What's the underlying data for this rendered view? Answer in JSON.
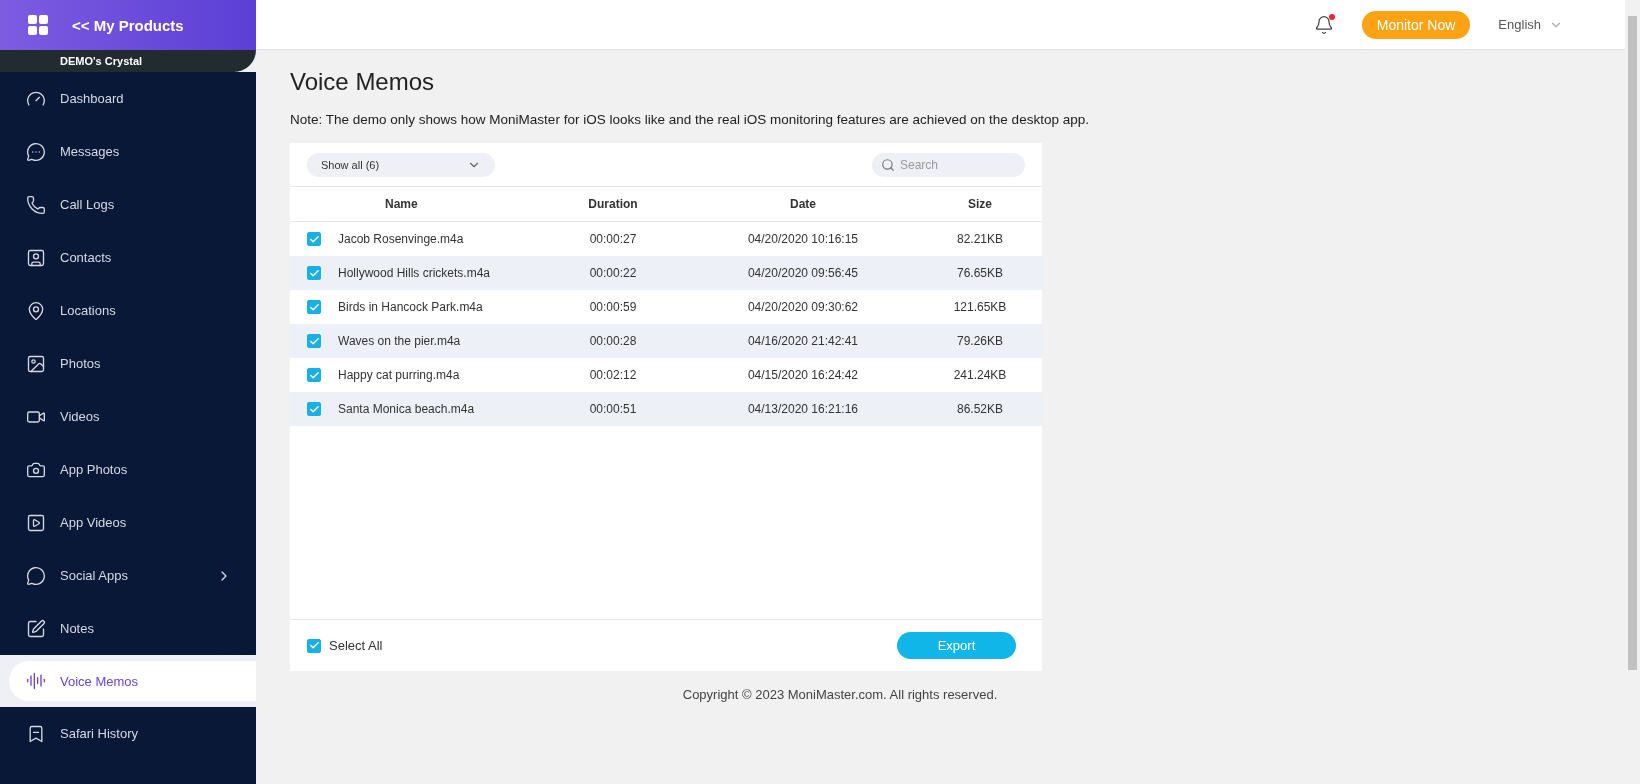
{
  "header": {
    "back_link": "<< My Products",
    "notification_unread": true,
    "monitor_button": "Monitor Now",
    "language": "English"
  },
  "sidebar": {
    "user_name": "DEMO's Crystal",
    "items": [
      {
        "label": "Dashboard",
        "selected": false,
        "has_submenu": false
      },
      {
        "label": "Messages",
        "selected": false,
        "has_submenu": false
      },
      {
        "label": "Call Logs",
        "selected": false,
        "has_submenu": false
      },
      {
        "label": "Contacts",
        "selected": false,
        "has_submenu": false
      },
      {
        "label": "Locations",
        "selected": false,
        "has_submenu": false
      },
      {
        "label": "Photos",
        "selected": false,
        "has_submenu": false
      },
      {
        "label": "Videos",
        "selected": false,
        "has_submenu": false
      },
      {
        "label": "App Photos",
        "selected": false,
        "has_submenu": false
      },
      {
        "label": "App Videos",
        "selected": false,
        "has_submenu": false
      },
      {
        "label": "Social Apps",
        "selected": false,
        "has_submenu": true
      },
      {
        "label": "Notes",
        "selected": false,
        "has_submenu": false
      },
      {
        "label": "Voice Memos",
        "selected": true,
        "has_submenu": false
      },
      {
        "label": "Safari History",
        "selected": false,
        "has_submenu": false
      }
    ]
  },
  "page": {
    "title": "Voice Memos",
    "note": "Note: The demo only shows how MoniMaster for iOS looks like and the real iOS monitoring features are achieved on the desktop app."
  },
  "table": {
    "filter": "Show all (6)",
    "search": {
      "placeholder": "Search"
    },
    "columns": [
      "Name",
      "Duration",
      "Date",
      "Size"
    ],
    "rows": [
      {
        "checked": true,
        "cells": [
          "Jacob Rosenvinge.m4a",
          "00:00:27",
          "04/20/2020 10:16:15",
          "82.21KB"
        ]
      },
      {
        "checked": true,
        "cells": [
          "Hollywood Hills crickets.m4a",
          "00:00:22",
          "04/20/2020 09:56:45",
          "76.65KB"
        ]
      },
      {
        "checked": true,
        "cells": [
          "Birds in Hancock Park.m4a",
          "00:00:59",
          "04/20/2020 09:30:62",
          "121.65KB"
        ]
      },
      {
        "checked": true,
        "cells": [
          "Waves on the pier.m4a",
          "00:00:28",
          "04/16/2020 21:42:41",
          "79.26KB"
        ]
      },
      {
        "checked": true,
        "cells": [
          "Happy cat purring.m4a",
          "00:02:12",
          "04/15/2020 16:24:42",
          "241.24KB"
        ]
      },
      {
        "checked": true,
        "cells": [
          "Santa Monica beach.m4a",
          "00:00:51",
          "04/13/2020 16:21:16",
          "86.52KB"
        ]
      }
    ],
    "select_all": {
      "label": "Select All",
      "checked": true
    },
    "export_button": "Export"
  },
  "footer": "Copyright © 2023 MoniMaster.com. All rights reserved."
}
